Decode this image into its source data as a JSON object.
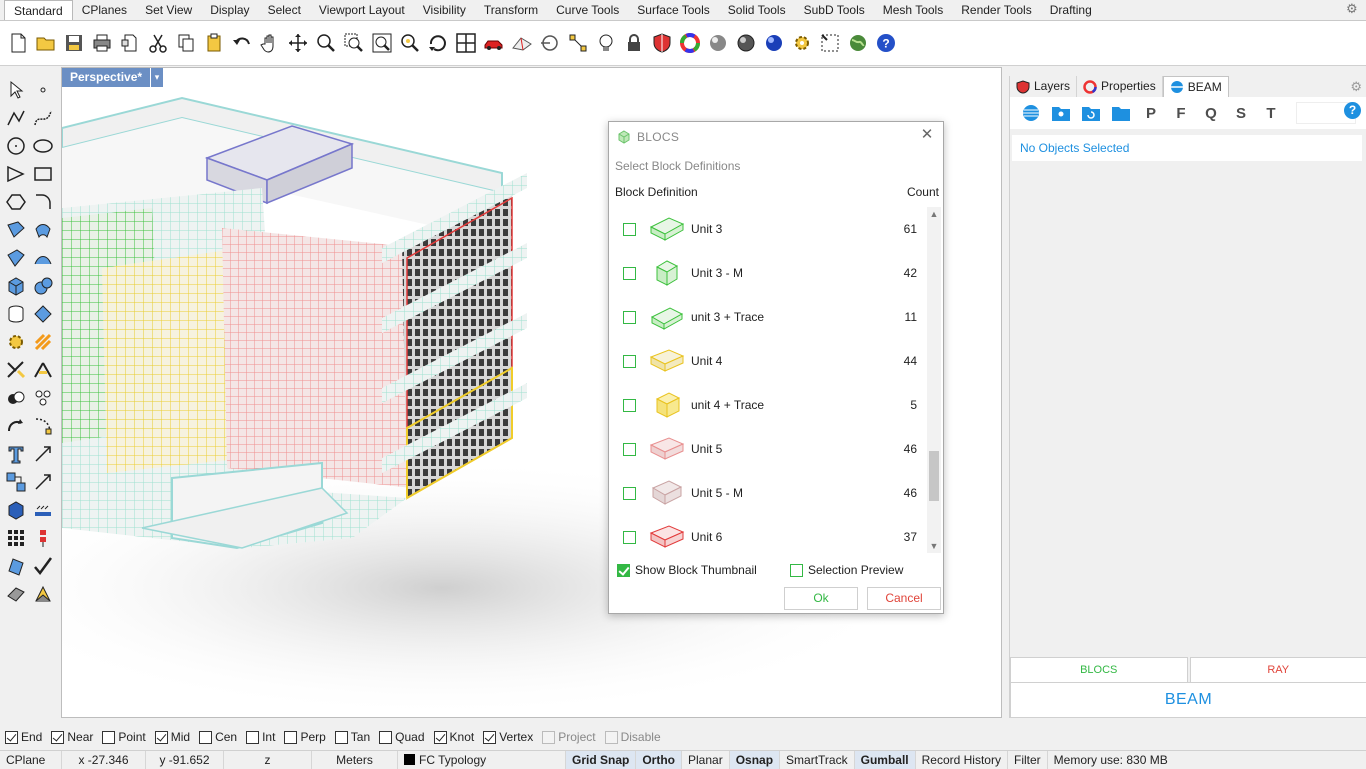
{
  "menu_tabs": [
    "Standard",
    "CPlanes",
    "Set View",
    "Display",
    "Select",
    "Viewport Layout",
    "Visibility",
    "Transform",
    "Curve Tools",
    "Surface Tools",
    "Solid Tools",
    "SubD Tools",
    "Mesh Tools",
    "Render Tools",
    "Drafting"
  ],
  "toolbar_icons": [
    "new-file",
    "open-folder",
    "save",
    "print",
    "import",
    "cut",
    "copy",
    "paste",
    "undo",
    "pan-hand",
    "move",
    "zoom",
    "zoom-window",
    "zoom-extents",
    "zoom-selected",
    "rotate-view",
    "four-viewports",
    "car",
    "plane-view",
    "circle-target",
    "point-osnap",
    "light-bulb",
    "lock",
    "layer-shield",
    "color-wheel",
    "sphere-gray",
    "sphere-shaded",
    "sphere-blue",
    "gear-settings",
    "grid-select",
    "globe",
    "help"
  ],
  "viewport": {
    "name": "Perspective*",
    "dropdown": "▾"
  },
  "dialog": {
    "title": "BLOCS",
    "subtitle": "Select Block Definitions",
    "col_definition": "Block Definition",
    "col_count": "Count",
    "rows": [
      {
        "label": "Unit 3",
        "count": "61",
        "color": "#3cc13c"
      },
      {
        "label": "Unit 3 - M",
        "count": "42",
        "color": "#3cc13c"
      },
      {
        "label": "unit 3 + Trace",
        "count": "11",
        "color": "#3cc13c"
      },
      {
        "label": "Unit 4",
        "count": "44",
        "color": "#f0d23a"
      },
      {
        "label": "unit 4 + Trace",
        "count": "5",
        "color": "#f0d23a"
      },
      {
        "label": "Unit 5",
        "count": "46",
        "color": "#f0a0a0"
      },
      {
        "label": "Unit 5 - M",
        "count": "46",
        "color": "#e7b0b0"
      },
      {
        "label": "Unit 6",
        "count": "37",
        "color": "#e23b3b"
      }
    ],
    "show_thumb": "Show Block Thumbnail",
    "sel_preview": "Selection Preview",
    "ok": "Ok",
    "cancel": "Cancel"
  },
  "panel": {
    "tabs": [
      "Layers",
      "Properties",
      "BEAM"
    ],
    "beam_letters": [
      "P",
      "F",
      "Q",
      "S",
      "T"
    ],
    "help": "?",
    "no_objects": "No Objects Selected",
    "btn_blocs": "BLOCS",
    "btn_ray": "RAY",
    "beam_big": "BEAM"
  },
  "osnap": [
    {
      "label": "End",
      "on": true
    },
    {
      "label": "Near",
      "on": true
    },
    {
      "label": "Point",
      "on": false
    },
    {
      "label": "Mid",
      "on": true
    },
    {
      "label": "Cen",
      "on": false
    },
    {
      "label": "Int",
      "on": false
    },
    {
      "label": "Perp",
      "on": false
    },
    {
      "label": "Tan",
      "on": false
    },
    {
      "label": "Quad",
      "on": false
    },
    {
      "label": "Knot",
      "on": true
    },
    {
      "label": "Vertex",
      "on": true
    },
    {
      "label": "Project",
      "on": false,
      "disabled": true
    },
    {
      "label": "Disable",
      "on": false,
      "disabled": true
    }
  ],
  "status": {
    "cplane": "CPlane",
    "x": "x -27.346",
    "y": "y -91.652",
    "z": "z",
    "units": "Meters",
    "layer": "FC Typology",
    "grid_snap": "Grid Snap",
    "ortho": "Ortho",
    "planar": "Planar",
    "osnap": "Osnap",
    "smarttrack": "SmartTrack",
    "gumball": "Gumball",
    "record": "Record History",
    "filter": "Filter",
    "memory": "Memory use: 830 MB"
  },
  "colors": {
    "accent_green": "#33b844",
    "accent_red": "#e0443a",
    "accent_blue": "#1e90e0",
    "viewport_tab": "#6b8fc4"
  }
}
